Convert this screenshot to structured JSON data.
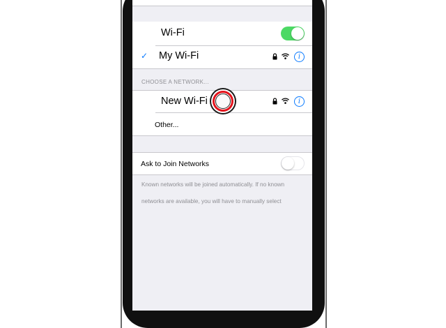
{
  "wifi_toggle": {
    "label": "Wi-Fi",
    "on": true
  },
  "current_network": {
    "name": "My Wi-Fi",
    "connected": true,
    "secured": true
  },
  "choose_header": "CHOOSE A NETWORK...",
  "networks": [
    {
      "name": "New Wi-Fi",
      "secured": true
    }
  ],
  "other_label": "Other...",
  "ask_to_join": {
    "label": "Ask to Join Networks",
    "on": false
  },
  "footer_text": "Known networks will be joined automatically. If no known networks are available, you will have to manually select",
  "colors": {
    "accent": "#0a7aff",
    "toggle_on": "#4cd964",
    "background": "#efeff4",
    "tap_indicator": "#e3111a"
  },
  "icons": {
    "check": "checkmark-icon",
    "lock": "lock-icon",
    "wifi": "wifi-signal-icon",
    "info": "info-icon",
    "tap": "tap-indicator-icon"
  }
}
